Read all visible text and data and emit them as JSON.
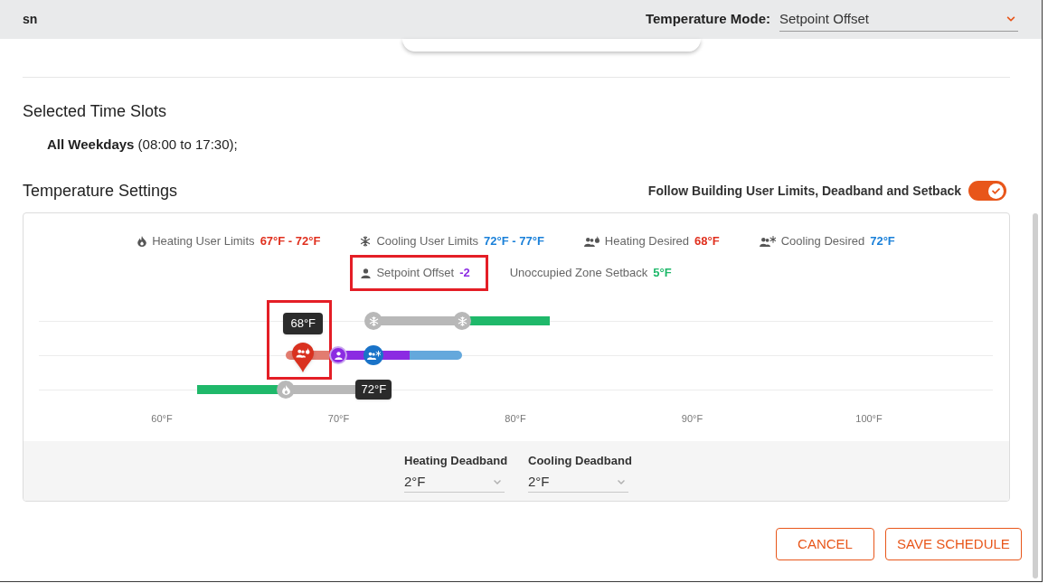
{
  "header": {
    "title": "sn",
    "mode_label": "Temperature Mode:",
    "mode_value": "Setpoint Offset"
  },
  "time_slots": {
    "title": "Selected Time Slots",
    "entries": [
      "**All Weekdays** (08:00 to 17:30);"
    ]
  },
  "temperature_settings": {
    "title": "Temperature Settings",
    "follow_building": {
      "label": "Follow Building User Limits, Deadband and Setback",
      "on": true
    },
    "legend": [
      {
        "items": [
          {
            "kind": "heating-limits",
            "label": "Heating User Limits",
            "value": "67°F - 72°F",
            "color": "#e0301e"
          },
          {
            "kind": "cooling-limits",
            "label": "Cooling User Limits",
            "value": "72°F - 77°F",
            "color": "#1a80d9"
          },
          {
            "kind": "heating-desired",
            "label": "Heating Desired",
            "value": "68°F",
            "color": "#e0301e"
          },
          {
            "kind": "cooling-desired",
            "label": "Cooling Desired",
            "value": "72°F",
            "color": "#1a80d9"
          }
        ]
      },
      {
        "items": [
          {
            "kind": "offset",
            "label": "Setpoint Offset",
            "value": "-2",
            "color": "#8b2be2",
            "highlighted": true
          },
          {
            "kind": "setback",
            "label": "Unoccupied Zone Setback",
            "value": "5°F",
            "color": "#1fb86a"
          }
        ]
      }
    ],
    "scale": {
      "rows": [
        {
          "segments": [
            {
              "kind": "empty",
              "level": 0.351
            },
            {
              "kind": "limit",
              "level": 0.444
            },
            {
              "kind": "setback",
              "level": 0.536
            }
          ],
          "handles": [
            {
              "kind": "cooling",
              "level": 0.351
            },
            {
              "kind": "cooling",
              "level": 0.444
            }
          ]
        },
        {
          "segments": [
            {
              "kind": "empty",
              "level": 0.259
            },
            {
              "kind": "heating",
              "level": 0.314
            },
            {
              "kind": "offset",
              "level": 0.389
            },
            {
              "kind": "cooling",
              "level": 0.444
            }
          ],
          "handles": [
            {
              "kind": "heating-desired",
              "level": 0.277,
              "tooltip": "68°F",
              "highlighted": true
            },
            {
              "kind": "offset",
              "level": 0.314
            },
            {
              "kind": "cooling-desired",
              "level": 0.351
            }
          ]
        },
        {
          "segments": [
            {
              "kind": "empty",
              "level": 0.166
            },
            {
              "kind": "setback",
              "level": 0.259
            },
            {
              "kind": "limit",
              "level": 0.351
            }
          ],
          "handles": [
            {
              "kind": "heating",
              "level": 0.259
            },
            {
              "kind": "heating",
              "level": 0.351,
              "tooltip": "72°F"
            }
          ]
        }
      ],
      "ticks": [
        "60°F",
        "70°F",
        "80°F",
        "90°F",
        "100°F"
      ]
    },
    "deadbands": [
      {
        "label": "Heating Deadband",
        "value": "2°F"
      },
      {
        "label": "Cooling Deadband",
        "value": "2°F"
      }
    ]
  },
  "buttons": [
    "CANCEL",
    "SAVE SCHEDULE"
  ]
}
